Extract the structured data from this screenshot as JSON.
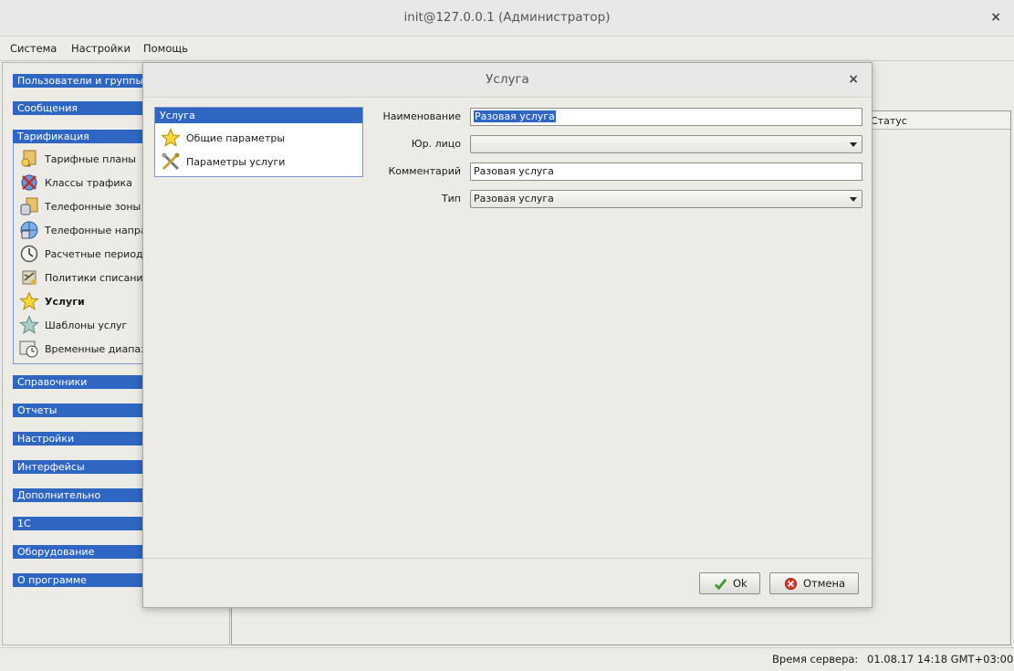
{
  "window": {
    "title": "init@127.0.0.1 (Администратор)",
    "close_glyph": "×"
  },
  "menu": [
    "Система",
    "Настройки",
    "Помощь"
  ],
  "sidebar": {
    "sections_top": [
      "Пользователи и группы",
      "Сообщения",
      "Тарификация"
    ],
    "items": [
      {
        "label": "Тарифные планы",
        "icon": "tariff-plans-icon"
      },
      {
        "label": "Классы трафика",
        "icon": "traffic-classes-icon"
      },
      {
        "label": "Телефонные зоны",
        "icon": "phone-zones-icon"
      },
      {
        "label": "Телефонные направления",
        "icon": "phone-directions-icon"
      },
      {
        "label": "Расчетные периоды",
        "icon": "billing-periods-icon"
      },
      {
        "label": "Политики списания",
        "icon": "charge-policies-icon"
      },
      {
        "label": "Услуги",
        "icon": "star-icon",
        "active": true
      },
      {
        "label": "Шаблоны услуг",
        "icon": "star-template-icon"
      },
      {
        "label": "Временные диапазоны",
        "icon": "time-ranges-icon"
      }
    ],
    "sections_bottom": [
      "Справочники",
      "Отчеты",
      "Настройки",
      "Интерфейсы",
      "Дополнительно",
      "1С",
      "Оборудование",
      "О программе"
    ]
  },
  "table": {
    "column_status": "Статус"
  },
  "status_bar": {
    "label": "Время сервера:",
    "value": "01.08.17 14:18 GMT+03:00"
  },
  "dialog": {
    "title": "Услуга",
    "close_glyph": "×",
    "tree": {
      "root": "Услуга",
      "items": [
        {
          "label": "Общие параметры",
          "icon": "star-icon"
        },
        {
          "label": "Параметры услуги",
          "icon": "tools-icon"
        }
      ]
    },
    "fields": {
      "name_label": "Наименование",
      "name_value": "Разовая услуга",
      "legal_label": "Юр. лицо",
      "legal_value": "",
      "comment_label": "Комментарий",
      "comment_value": "Разовая услуга",
      "type_label": "Тип",
      "type_value": "Разовая услуга"
    },
    "buttons": {
      "ok": "Ok",
      "cancel": "Отмена"
    }
  },
  "colors": {
    "accent": "#2e66c2",
    "background": "#ecebe6"
  }
}
